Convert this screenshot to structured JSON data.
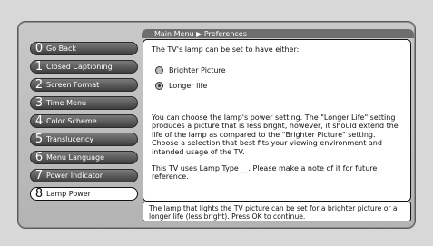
{
  "breadcrumb": "Main Menu ▶ Preferences",
  "menu": [
    {
      "num": "0",
      "label": "Go Back"
    },
    {
      "num": "1",
      "label": "Closed Captioning"
    },
    {
      "num": "2",
      "label": "Screen Format"
    },
    {
      "num": "3",
      "label": "Time Menu"
    },
    {
      "num": "4",
      "label": "Color Scheme"
    },
    {
      "num": "5",
      "label": "Translucency"
    },
    {
      "num": "6",
      "label": "Menu Language"
    },
    {
      "num": "7",
      "label": "Power Indicator"
    },
    {
      "num": "8",
      "label": "Lamp Power"
    }
  ],
  "panel": {
    "intro": "The TV's lamp can be set to have either:",
    "options": [
      "Brighter Picture",
      "Longer life"
    ],
    "description": "You can choose the lamp's power setting. The \"Longer Life\" setting produces a picture that is less bright, however, it should extend the life of the lamp as compared to the \"Brighter Picture\" setting. Choose a selection that best fits your viewing environment and intended usage of the TV.",
    "lamp_note": "This TV uses Lamp Type __. Please make a note of it for future reference."
  },
  "help": "The lamp that lights the TV picture can be set for a brighter picture or a longer life (less bright). Press OK to continue."
}
